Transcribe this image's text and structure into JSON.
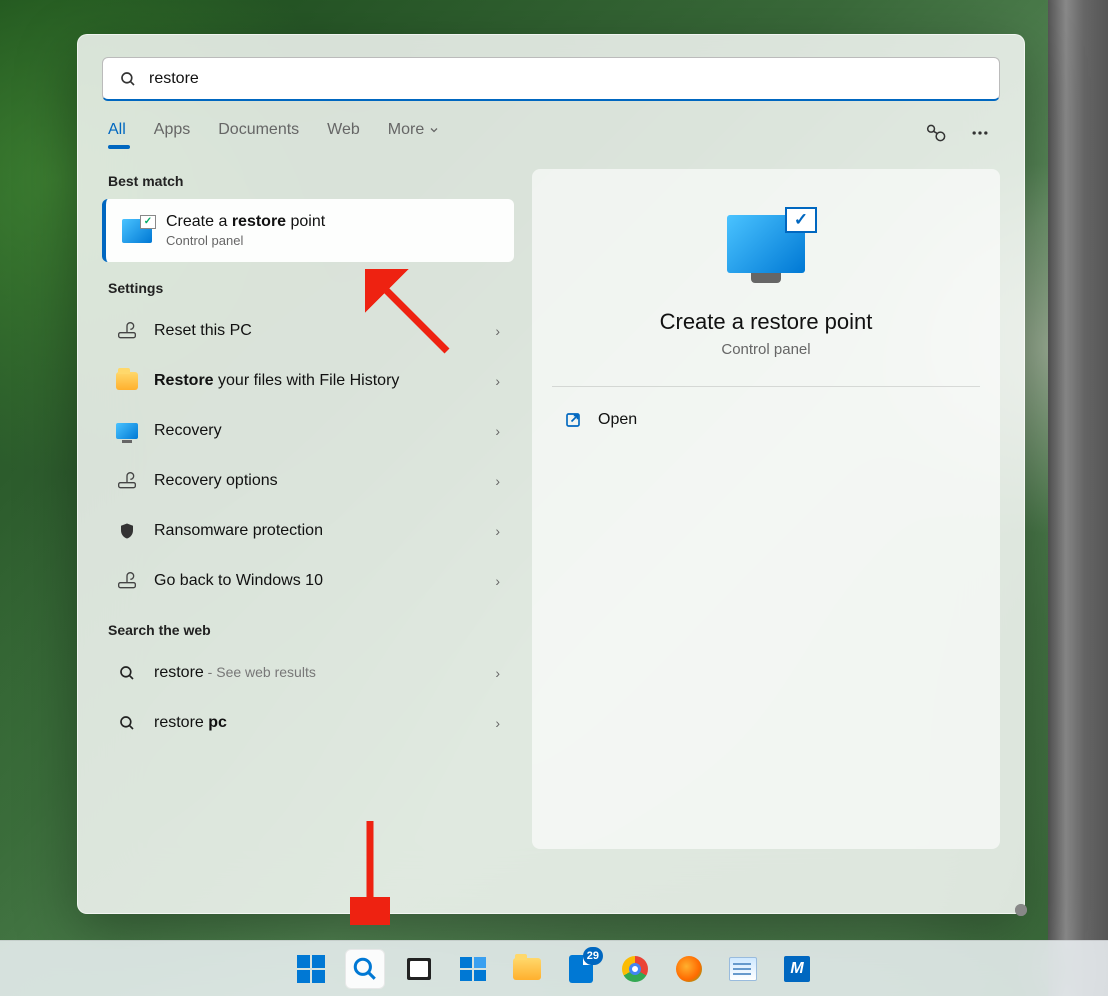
{
  "search": {
    "query": "restore"
  },
  "filters": {
    "all": "All",
    "apps": "Apps",
    "documents": "Documents",
    "web": "Web",
    "more": "More"
  },
  "sections": {
    "best_match": "Best match",
    "settings": "Settings",
    "search_web": "Search the web"
  },
  "best_match": {
    "title_pre": "Create a ",
    "title_bold": "restore",
    "title_post": " point",
    "subtitle": "Control panel"
  },
  "settings_items": {
    "reset": "Reset this PC",
    "file_history_bold": "Restore",
    "file_history_rest": " your files with File History",
    "recovery": "Recovery",
    "recovery_options": "Recovery options",
    "ransomware": "Ransomware protection",
    "goback": "Go back to Windows 10"
  },
  "web_items": {
    "restore_term": "restore",
    "restore_suffix": " - See web results",
    "restore_pc_pre": "restore ",
    "restore_pc_bold": "pc"
  },
  "preview": {
    "title": "Create a restore point",
    "subtitle": "Control panel",
    "open": "Open"
  },
  "taskbar": {
    "badge_count": "29"
  }
}
